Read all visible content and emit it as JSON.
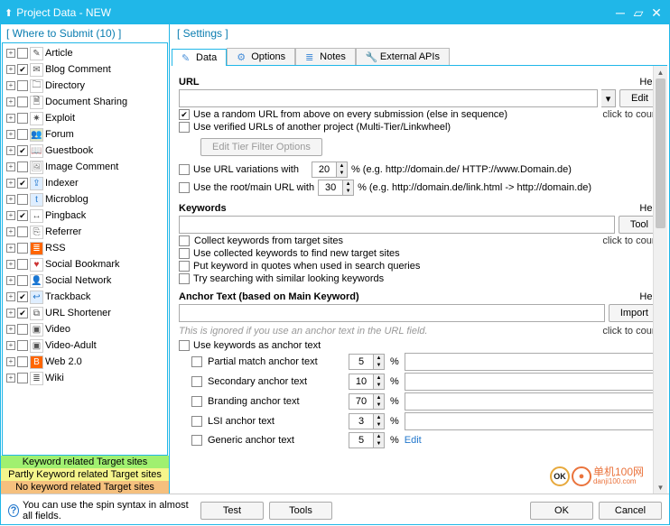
{
  "window": {
    "title": "Project Data - NEW"
  },
  "panels": {
    "left_title": "[ Where to Submit  (10) ]",
    "right_title": "[ Settings ]"
  },
  "tree_items": [
    {
      "label": "Article",
      "checked": false,
      "bg": "#fff",
      "fg": "#555",
      "glyph": "✎"
    },
    {
      "label": "Blog Comment",
      "checked": true,
      "bg": "#fff",
      "fg": "#555",
      "glyph": "✉"
    },
    {
      "label": "Directory",
      "checked": false,
      "bg": "#fff",
      "fg": "#555",
      "glyph": "🗀"
    },
    {
      "label": "Document Sharing",
      "checked": false,
      "bg": "#fff",
      "fg": "#555",
      "glyph": "🗎"
    },
    {
      "label": "Exploit",
      "checked": false,
      "bg": "#fff",
      "fg": "#555",
      "glyph": "✷"
    },
    {
      "label": "Forum",
      "checked": false,
      "bg": "#e0e8c8",
      "fg": "#333",
      "glyph": "👥"
    },
    {
      "label": "Guestbook",
      "checked": true,
      "bg": "#fff",
      "fg": "#7a5",
      "glyph": "📖"
    },
    {
      "label": "Image Comment",
      "checked": false,
      "bg": "#fff",
      "fg": "#888",
      "glyph": "🖼"
    },
    {
      "label": "Indexer",
      "checked": true,
      "bg": "#dfeeff",
      "fg": "#27c",
      "glyph": "⇪"
    },
    {
      "label": "Microblog",
      "checked": false,
      "bg": "#dfeeff",
      "fg": "#27c",
      "glyph": "t"
    },
    {
      "label": "Pingback",
      "checked": true,
      "bg": "#fff",
      "fg": "#555",
      "glyph": "↔"
    },
    {
      "label": "Referrer",
      "checked": false,
      "bg": "#fff",
      "fg": "#555",
      "glyph": "⎘"
    },
    {
      "label": "RSS",
      "checked": false,
      "bg": "#f60",
      "fg": "#fff",
      "glyph": "≣"
    },
    {
      "label": "Social Bookmark",
      "checked": false,
      "bg": "#fff",
      "fg": "#c33",
      "glyph": "♥"
    },
    {
      "label": "Social Network",
      "checked": false,
      "bg": "#fff",
      "fg": "#555",
      "glyph": "👤"
    },
    {
      "label": "Trackback",
      "checked": true,
      "bg": "#dfeeff",
      "fg": "#27c",
      "glyph": "↩"
    },
    {
      "label": "URL Shortener",
      "checked": true,
      "bg": "#fff",
      "fg": "#555",
      "glyph": "⧉"
    },
    {
      "label": "Video",
      "checked": false,
      "bg": "#fff",
      "fg": "#555",
      "glyph": "▣"
    },
    {
      "label": "Video-Adult",
      "checked": false,
      "bg": "#fff",
      "fg": "#555",
      "glyph": "▣"
    },
    {
      "label": "Web 2.0",
      "checked": false,
      "bg": "#f60",
      "fg": "#fff",
      "glyph": "B"
    },
    {
      "label": "Wiki",
      "checked": false,
      "bg": "#fff",
      "fg": "#555",
      "glyph": "≣"
    }
  ],
  "legend": {
    "l1": "Keyword related Target sites",
    "l2": "Partly Keyword related Target sites",
    "l3": "No keyword related Target sites"
  },
  "tabs": [
    {
      "label": "Data",
      "active": true
    },
    {
      "label": "Options",
      "active": false
    },
    {
      "label": "Notes",
      "active": false
    },
    {
      "label": "External APIs",
      "active": false
    }
  ],
  "url_section": {
    "title": "URL",
    "help": "Help",
    "edit_btn": "Edit",
    "click_count": "click to count",
    "opt_random": "Use a random URL from above on every submission (else in sequence)",
    "opt_verified": "Use verified URLs of another project (Multi-Tier/Linkwheel)",
    "tier_filter_btn": "Edit Tier Filter Options",
    "opt_variations": "Use URL variations with",
    "variations_val": "20",
    "variations_hint": "%  (e.g. http://domain.de/ HTTP://www.Domain.de)",
    "opt_rootmain": "Use the root/main URL with",
    "rootmain_val": "30",
    "rootmain_hint": "%  (e.g. http://domain.de/link.html -> http://domain.de)"
  },
  "kw_section": {
    "title": "Keywords",
    "help": "Help",
    "tool_btn": "Tool",
    "click_count": "click to count",
    "opt_collect": "Collect keywords from target sites",
    "opt_collected": "Use collected keywords to find new target sites",
    "opt_quotes": "Put keyword in quotes when used in search queries",
    "opt_similar": "Try searching with similar looking keywords"
  },
  "anchor_section": {
    "title": "Anchor Text (based on Main Keyword)",
    "help": "Help",
    "import_btn": "Import",
    "click_count": "click to count",
    "hint": "This is ignored if you use an anchor text in the URL field.",
    "opt_use_kw": "Use keywords as anchor text",
    "rows": [
      {
        "label": "Partial match anchor text",
        "val": "5"
      },
      {
        "label": "Secondary anchor text",
        "val": "10"
      },
      {
        "label": "Branding anchor text",
        "val": "70"
      },
      {
        "label": "LSI anchor text",
        "val": "3"
      },
      {
        "label": "Generic anchor text",
        "val": "5"
      }
    ],
    "edit_link": "Edit"
  },
  "footer": {
    "hint": "You can use the spin syntax in almost all fields.",
    "test": "Test",
    "tools": "Tools",
    "ok": "OK",
    "cancel": "Cancel"
  },
  "watermark": {
    "ok": "OK",
    "site": "danji100.com",
    "brand": "单机100网"
  }
}
